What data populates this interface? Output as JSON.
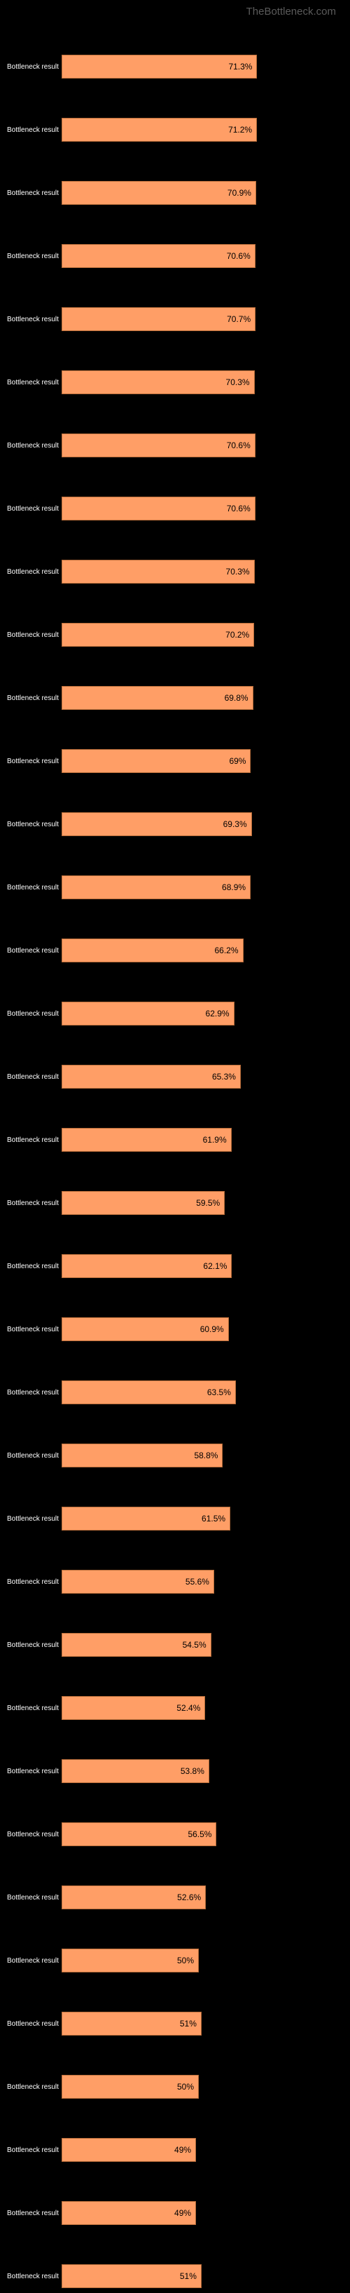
{
  "watermark": "TheBottleneck.com",
  "label_text": "Bottleneck result",
  "bar_color": "#ff9e66",
  "bar_border_color": "#b86d3a",
  "max_value": 100,
  "chart_data": {
    "type": "bar",
    "title": "",
    "xlabel": "",
    "ylabel": "",
    "ylim": [
      0,
      100
    ],
    "categories": [
      "Bottleneck result",
      "Bottleneck result",
      "Bottleneck result",
      "Bottleneck result",
      "Bottleneck result",
      "Bottleneck result",
      "Bottleneck result",
      "Bottleneck result",
      "Bottleneck result",
      "Bottleneck result",
      "Bottleneck result",
      "Bottleneck result",
      "Bottleneck result",
      "Bottleneck result",
      "Bottleneck result",
      "Bottleneck result",
      "Bottleneck result",
      "Bottleneck result",
      "Bottleneck result",
      "Bottleneck result",
      "Bottleneck result",
      "Bottleneck result",
      "Bottleneck result",
      "Bottleneck result",
      "Bottleneck result",
      "Bottleneck result",
      "Bottleneck result",
      "Bottleneck result",
      "Bottleneck result",
      "Bottleneck result",
      "Bottleneck result",
      "Bottleneck result",
      "Bottleneck result",
      "Bottleneck result",
      "Bottleneck result",
      "Bottleneck result"
    ],
    "values": [
      71.3,
      71.2,
      70.9,
      70.6,
      70.7,
      70.3,
      70.6,
      70.6,
      70.3,
      70.2,
      69.8,
      69.0,
      69.3,
      68.9,
      66.2,
      62.9,
      65.3,
      61.9,
      59.5,
      62.1,
      60.9,
      63.5,
      58.8,
      61.5,
      55.6,
      54.5,
      52.4,
      53.8,
      56.5,
      52.6,
      50.0,
      51.0,
      50.0,
      49.0,
      49.0,
      51.0
    ],
    "display_values": [
      "71.3%",
      "71.2%",
      "70.9%",
      "70.6%",
      "70.7%",
      "70.3%",
      "70.6%",
      "70.6%",
      "70.3%",
      "70.2%",
      "69.8%",
      "69%",
      "69.3%",
      "68.9%",
      "66.2%",
      "62.9%",
      "65.3%",
      "61.9%",
      "59.5%",
      "62.1%",
      "60.9%",
      "63.5%",
      "58.8%",
      "61.5%",
      "55.6%",
      "54.5%",
      "52.4%",
      "53.8%",
      "56.5%",
      "52.6%",
      "50%",
      "51%",
      "50%",
      "49%",
      "49%",
      "51%"
    ]
  }
}
